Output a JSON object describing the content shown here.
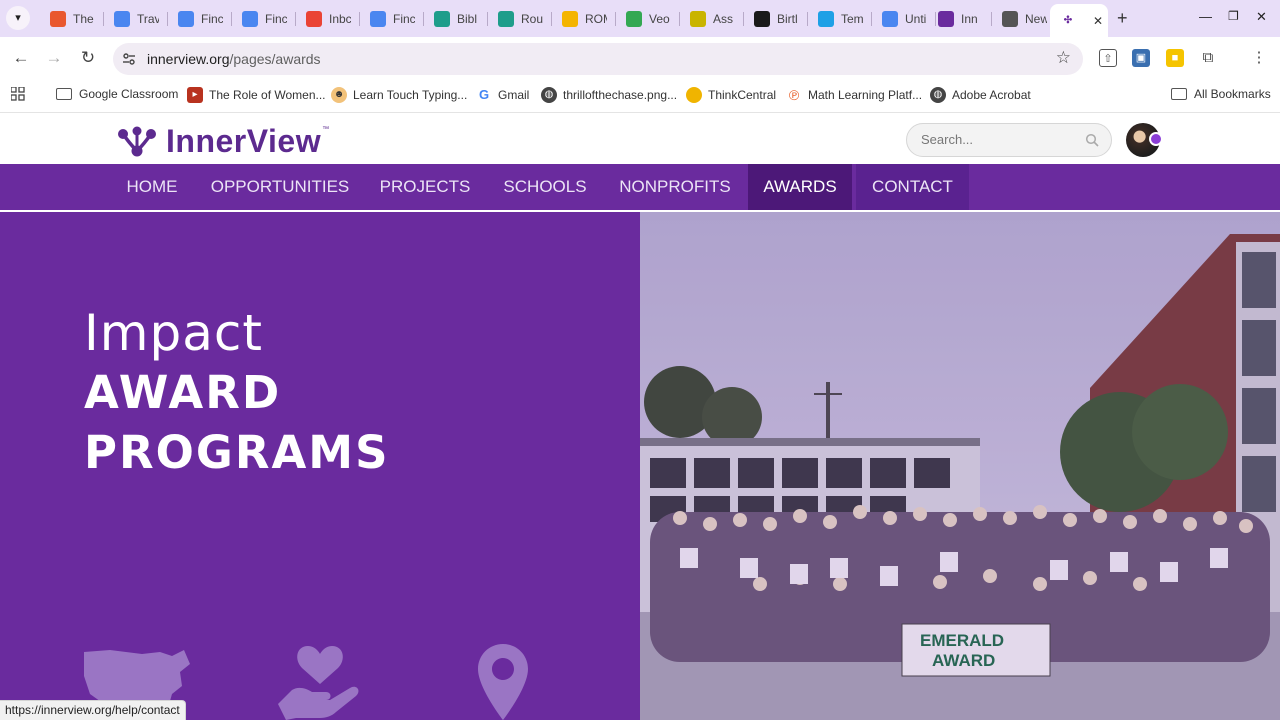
{
  "browser": {
    "tabs": [
      {
        "title": "The",
        "favicon": "chrome-c-icon",
        "color": "#e9582f"
      },
      {
        "title": "Trav",
        "favicon": "docs-icon",
        "color": "#4a86f0"
      },
      {
        "title": "Finc",
        "favicon": "docs-icon",
        "color": "#4a86f0"
      },
      {
        "title": "Finc",
        "favicon": "docs-icon",
        "color": "#4a86f0"
      },
      {
        "title": "Inbc",
        "favicon": "gmail-icon",
        "color": "#ea4335"
      },
      {
        "title": "Finc",
        "favicon": "docs-icon",
        "color": "#4a86f0"
      },
      {
        "title": "Bibl",
        "favicon": "classroom-icon",
        "color": "#1e9d8b"
      },
      {
        "title": "Rou",
        "favicon": "classroom-icon",
        "color": "#1e9d8b"
      },
      {
        "title": "ROM",
        "favicon": "slides-icon",
        "color": "#f4b400"
      },
      {
        "title": "Veo",
        "favicon": "sheets-icon",
        "color": "#34a853"
      },
      {
        "title": "Ass",
        "favicon": "classroom-icon",
        "color": "#c9b400"
      },
      {
        "title": "Birtl",
        "favicon": "c-letter-icon",
        "color": "#1a1a1a"
      },
      {
        "title": "Tem",
        "favicon": "canva-icon",
        "color": "#1ea0e6"
      },
      {
        "title": "Unti",
        "favicon": "forms-icon",
        "color": "#4a86f0"
      },
      {
        "title": "Inn",
        "favicon": "innerview-icon",
        "color": "#6a2b9e"
      },
      {
        "title": "New",
        "favicon": "globe-icon",
        "color": "#555555"
      }
    ],
    "active_tab_index": 16,
    "active_tab_close": "✕",
    "new_tab_label": "+",
    "url_host": "innerview.org",
    "url_path": "/pages/awards",
    "bookmarks": [
      {
        "label": "Google Classroom",
        "icon": "folder-icon"
      },
      {
        "label": "The Role of Women...",
        "icon": "book-icon"
      },
      {
        "label": "Learn Touch Typing...",
        "icon": "typing-icon"
      },
      {
        "label": "Gmail",
        "icon": "google-icon"
      },
      {
        "label": "thrillofthechase.png...",
        "icon": "globe-icon"
      },
      {
        "label": "ThinkCentral",
        "icon": "thinkcentral-icon"
      },
      {
        "label": "Math Learning Platf...",
        "icon": "math-icon"
      },
      {
        "label": "Adobe Acrobat",
        "icon": "globe-icon"
      }
    ],
    "all_bookmarks": "All Bookmarks",
    "status_url": "https://innerview.org/help/contact"
  },
  "site": {
    "logo_text": "InnerView",
    "logo_tm": "™",
    "search_placeholder": "Search...",
    "nav": [
      "HOME",
      "OPPORTUNITIES",
      "PROJECTS",
      "SCHOOLS",
      "NONPROFITS",
      "AWARDS",
      "CONTACT"
    ],
    "active_nav": "AWARDS",
    "colors": {
      "brand_purple": "#6a2b9e",
      "nav_active": "#4c1878"
    }
  },
  "hero": {
    "line1": "Impact",
    "line2": "AWARD",
    "line3": "PROGRAMS",
    "icons": [
      "usa-map-icon",
      "heart-hand-icon",
      "map-pin-icon"
    ],
    "photo_banner_top": "EMERALD",
    "photo_banner_bottom": "AWARD"
  }
}
